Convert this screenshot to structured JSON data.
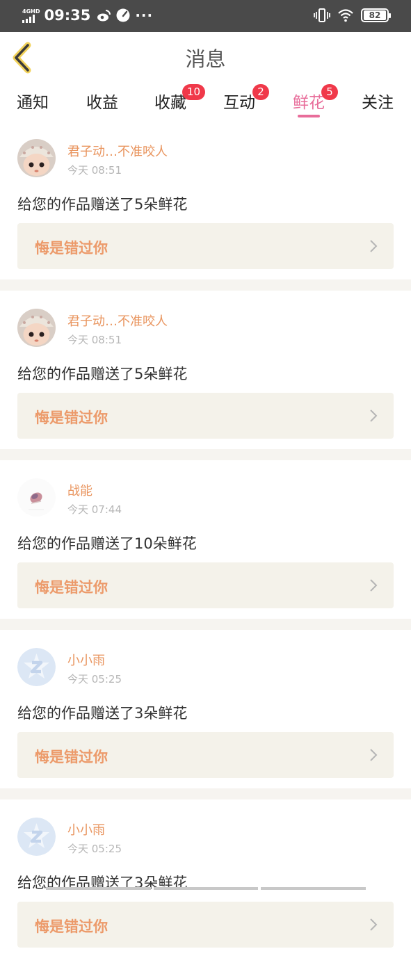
{
  "status_bar": {
    "network": "4GHD",
    "time": "09:35",
    "more": "···",
    "battery": "82"
  },
  "header": {
    "title": "消息"
  },
  "tabs": [
    {
      "label": "通知",
      "badge": ""
    },
    {
      "label": "收益",
      "badge": ""
    },
    {
      "label": "收藏",
      "badge": "10"
    },
    {
      "label": "互动",
      "badge": "2"
    },
    {
      "label": "鲜花",
      "badge": "5"
    },
    {
      "label": "关注",
      "badge": ""
    }
  ],
  "active_tab": "鲜花",
  "colors": {
    "accent_pink": "#e86d9a",
    "name_orange": "#e9955f",
    "badge_red": "#f0394a",
    "work_bg": "#f4f2ea"
  },
  "feed": [
    {
      "name": "君子动…不准咬人",
      "time": "今天 08:51",
      "message": "给您的作品赠送了5朵鲜花",
      "work_title": "悔是错过你",
      "avatar": "doll-avatar"
    },
    {
      "name": "君子动…不准咬人",
      "time": "今天 08:51",
      "message": "给您的作品赠送了5朵鲜花",
      "work_title": "悔是错过你",
      "avatar": "doll-avatar"
    },
    {
      "name": "战能",
      "time": "今天 07:44",
      "message": "给您的作品赠送了10朵鲜花",
      "work_title": "悔是错过你",
      "avatar": "sticker-avatar"
    },
    {
      "name": "小小雨",
      "time": "今天 05:25",
      "message": "给您的作品赠送了3朵鲜花",
      "work_title": "悔是错过你",
      "avatar": "default-z-avatar"
    },
    {
      "name": "小小雨",
      "time": "今天 05:25",
      "message": "给您的作品赠送了3朵鲜花",
      "work_title": "悔是错过你",
      "avatar": "default-z-avatar"
    }
  ]
}
